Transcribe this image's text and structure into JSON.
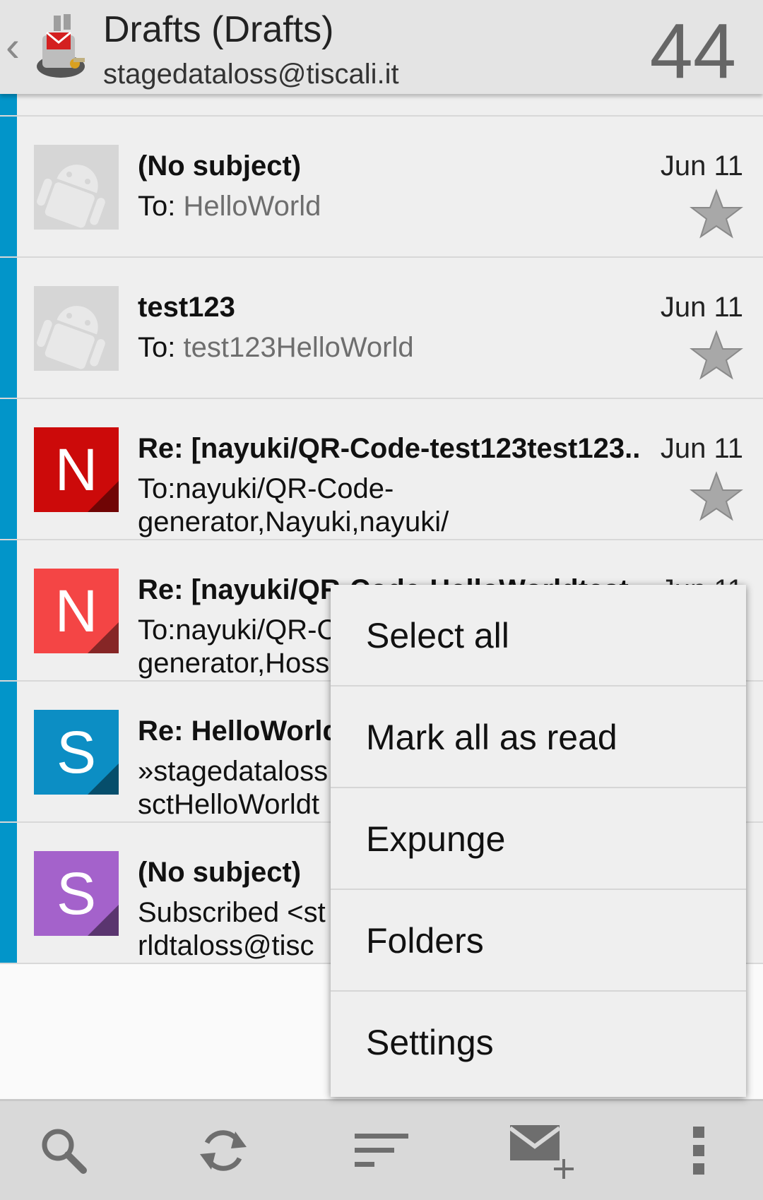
{
  "header": {
    "folder_title": "Drafts (Drafts)",
    "account_email": "stagedataloss@tiscali.it",
    "unread_count": "44"
  },
  "messages": [
    {
      "subject": "(No subject)",
      "to_label": "To: ",
      "to_value": "HelloWorld",
      "date": "Jun 11",
      "avatar": "placeholder"
    },
    {
      "subject": "test123",
      "to_label": "To: ",
      "to_value": "test123HelloWorld",
      "date": "Jun 11",
      "avatar": "placeholder"
    },
    {
      "subject": "Re: [nayuki/QR-Code-test123test123..",
      "to_label": "To:nayuki/QR-Code-generator,Nayuki,nayuki/",
      "to_value": "",
      "date": "Jun 11",
      "avatar_letter": "N",
      "avatar_color": "#cc0a0a"
    },
    {
      "subject": "Re: [nayuki/QR-Code-HelloWorldtest..",
      "to_label": "To:nayuki/QR-Code-generator,Hoss",
      "to_value": "",
      "date": "Jun 11",
      "avatar_letter": "N",
      "avatar_color": "#f44545"
    },
    {
      "subject": "Re: HelloWorld",
      "to_label": "»stagedataloss sctHelloWorldt",
      "to_value": "",
      "date": "",
      "avatar_letter": "S",
      "avatar_color": "#0c8ec4"
    },
    {
      "subject": "(No subject)",
      "to_label": "Subscribed <st rldtaloss@tisc",
      "to_value": "",
      "date": "",
      "avatar_letter": "S",
      "avatar_color": "#a462cb"
    }
  ],
  "menu": {
    "items": [
      "Select all",
      "Mark all as read",
      "Expunge",
      "Folders",
      "Settings"
    ]
  },
  "toolbar": {
    "icons": [
      "search-icon",
      "refresh-icon",
      "sort-icon",
      "compose-icon",
      "overflow-menu-icon"
    ]
  },
  "colors": {
    "accent_bar": "#0295c9",
    "star": "#a8a8a8"
  }
}
